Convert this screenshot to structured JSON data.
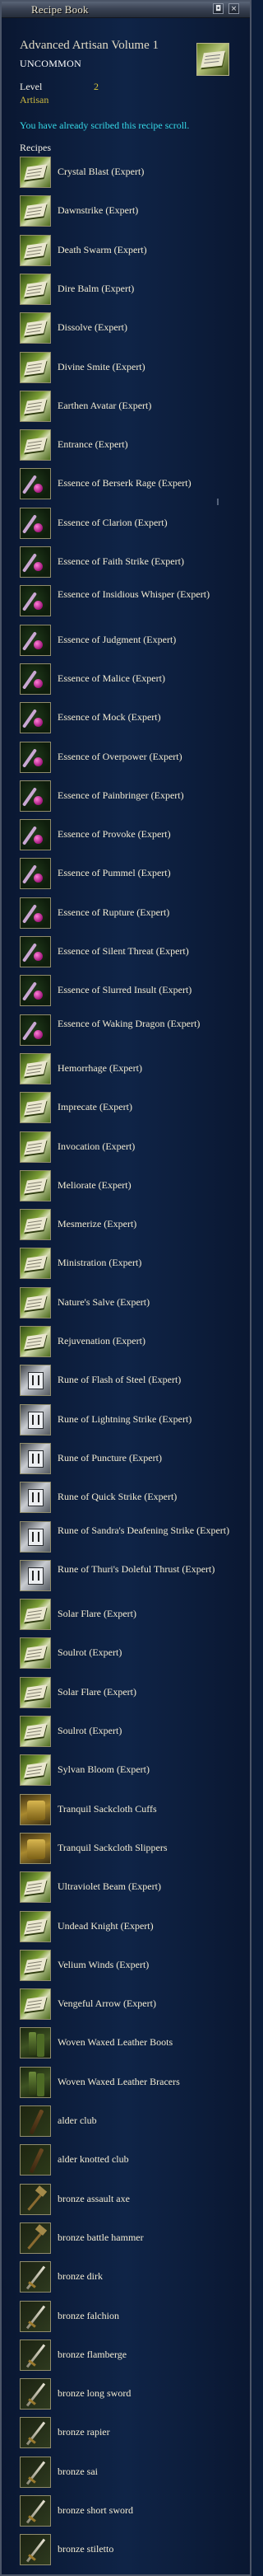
{
  "window": {
    "title": "Recipe Book",
    "btn_pin": "◘",
    "btn_close": "×"
  },
  "book": {
    "name": "Advanced Artisan Volume 1",
    "rarity": "UNCOMMON",
    "level_label": "Level",
    "level_value": "2",
    "class_label": "Artisan",
    "scribed_message": "You have already scribed this recipe scroll.",
    "recipes_label": "Recipes"
  },
  "recipes": [
    {
      "label": "Crystal Blast (Expert)",
      "icon": "scroll-icon"
    },
    {
      "label": "Dawnstrike (Expert)",
      "icon": "scroll-icon"
    },
    {
      "label": "Death Swarm (Expert)",
      "icon": "scroll-icon"
    },
    {
      "label": "Dire Balm (Expert)",
      "icon": "scroll-icon"
    },
    {
      "label": "Dissolve (Expert)",
      "icon": "scroll-icon"
    },
    {
      "label": "Divine Smite (Expert)",
      "icon": "scroll-icon"
    },
    {
      "label": "Earthen Avatar (Expert)",
      "icon": "scroll-icon"
    },
    {
      "label": "Entrance (Expert)",
      "icon": "scroll-icon"
    },
    {
      "label": "Essence of Berserk Rage (Expert)",
      "icon": "essence-icon"
    },
    {
      "label": "Essence of Clarion (Expert)",
      "icon": "essence-icon"
    },
    {
      "label": "Essence of Faith Strike (Expert)",
      "icon": "essence-icon"
    },
    {
      "label": "Essence of Insidious Whisper (Expert)",
      "icon": "essence-icon"
    },
    {
      "label": "Essence of Judgment (Expert)",
      "icon": "essence-icon"
    },
    {
      "label": "Essence of Malice (Expert)",
      "icon": "essence-icon"
    },
    {
      "label": "Essence of Mock (Expert)",
      "icon": "essence-icon"
    },
    {
      "label": "Essence of Overpower (Expert)",
      "icon": "essence-icon"
    },
    {
      "label": "Essence of Painbringer (Expert)",
      "icon": "essence-icon"
    },
    {
      "label": "Essence of Provoke (Expert)",
      "icon": "essence-icon"
    },
    {
      "label": "Essence of Pummel (Expert)",
      "icon": "essence-icon"
    },
    {
      "label": "Essence of Rupture (Expert)",
      "icon": "essence-icon"
    },
    {
      "label": "Essence of Silent Threat (Expert)",
      "icon": "essence-icon"
    },
    {
      "label": "Essence of Slurred Insult (Expert)",
      "icon": "essence-icon"
    },
    {
      "label": "Essence of Waking Dragon (Expert)",
      "icon": "essence-icon"
    },
    {
      "label": "Hemorrhage (Expert)",
      "icon": "scroll-icon"
    },
    {
      "label": "Imprecate (Expert)",
      "icon": "scroll-icon"
    },
    {
      "label": "Invocation (Expert)",
      "icon": "scroll-icon"
    },
    {
      "label": "Meliorate (Expert)",
      "icon": "scroll-icon"
    },
    {
      "label": "Mesmerize (Expert)",
      "icon": "scroll-icon"
    },
    {
      "label": "Ministration (Expert)",
      "icon": "scroll-icon"
    },
    {
      "label": "Nature's Salve (Expert)",
      "icon": "scroll-icon"
    },
    {
      "label": "Rejuvenation (Expert)",
      "icon": "scroll-icon"
    },
    {
      "label": "Rune of Flash of Steel (Expert)",
      "icon": "rune-icon"
    },
    {
      "label": "Rune of Lightning Strike (Expert)",
      "icon": "rune-icon"
    },
    {
      "label": "Rune of Puncture (Expert)",
      "icon": "rune-icon"
    },
    {
      "label": "Rune of Quick Strike (Expert)",
      "icon": "rune-icon"
    },
    {
      "label": "Rune of Sandra's Deafening Strike (Expert)",
      "icon": "rune-icon"
    },
    {
      "label": "Rune of Thuri's Doleful Thrust (Expert)",
      "icon": "rune-icon"
    },
    {
      "label": "Solar Flare (Expert)",
      "icon": "scroll-icon"
    },
    {
      "label": "Soulrot (Expert)",
      "icon": "scroll-icon"
    },
    {
      "label": "Solar Flare (Expert)",
      "icon": "scroll-icon"
    },
    {
      "label": "Soulrot (Expert)",
      "icon": "scroll-icon"
    },
    {
      "label": "Sylvan Bloom (Expert)",
      "icon": "scroll-icon"
    },
    {
      "label": "Tranquil Sackcloth Cuffs",
      "icon": "cloth-icon"
    },
    {
      "label": "Tranquil Sackcloth Slippers",
      "icon": "cloth-icon"
    },
    {
      "label": "Ultraviolet Beam (Expert)",
      "icon": "scroll-icon"
    },
    {
      "label": "Undead Knight (Expert)",
      "icon": "scroll-icon"
    },
    {
      "label": "Velium Winds (Expert)",
      "icon": "scroll-icon"
    },
    {
      "label": "Vengeful Arrow (Expert)",
      "icon": "scroll-icon"
    },
    {
      "label": "Woven Waxed Leather Boots",
      "icon": "leather-icon"
    },
    {
      "label": "Woven Waxed Leather Bracers",
      "icon": "leather-icon"
    },
    {
      "label": "alder club",
      "icon": "club-icon"
    },
    {
      "label": "alder knotted club",
      "icon": "club-icon"
    },
    {
      "label": "bronze assault axe",
      "icon": "axe-icon"
    },
    {
      "label": "bronze battle hammer",
      "icon": "hammer-icon"
    },
    {
      "label": "bronze dirk",
      "icon": "dagger-icon"
    },
    {
      "label": "bronze falchion",
      "icon": "sword-icon"
    },
    {
      "label": "bronze flamberge",
      "icon": "sword-icon"
    },
    {
      "label": "bronze long sword",
      "icon": "sword-icon"
    },
    {
      "label": "bronze rapier",
      "icon": "sword-icon"
    },
    {
      "label": "bronze sai",
      "icon": "sai-icon"
    },
    {
      "label": "bronze short sword",
      "icon": "sword-icon"
    },
    {
      "label": "bronze stiletto",
      "icon": "dagger-icon"
    }
  ]
}
